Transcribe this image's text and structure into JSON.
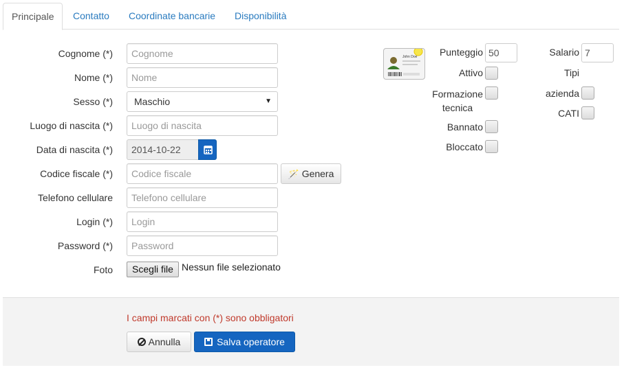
{
  "tabs": [
    "Principale",
    "Contatto",
    "Coordinate bancarie",
    "Disponibilità"
  ],
  "form": {
    "cognome_label": "Cognome (*)",
    "cognome_placeholder": "Cognome",
    "nome_label": "Nome (*)",
    "nome_placeholder": "Nome",
    "sesso_label": "Sesso (*)",
    "sesso_value": "Maschio",
    "luogo_label": "Luogo di nascita (*)",
    "luogo_placeholder": "Luogo di nascita",
    "data_label": "Data di nascita (*)",
    "data_value": "2014-10-22",
    "codice_label": "Codice fiscale (*)",
    "codice_placeholder": "Codice fiscale",
    "genera_label": "Genera",
    "telefono_label": "Telefono cellulare",
    "telefono_placeholder": "Telefono cellulare",
    "login_label": "Login (*)",
    "login_placeholder": "Login",
    "password_label": "Password (*)",
    "password_placeholder": "Password",
    "foto_label": "Foto",
    "file_button": "Scegli file",
    "file_status": "Nessun file selezionato"
  },
  "right": {
    "card_name": "John Doe",
    "punteggio_label": "Punteggio",
    "punteggio_value": "50",
    "salario_label": "Salario",
    "salario_value": "7",
    "attivo_label": "Attivo",
    "formazione_label_1": "Formazione",
    "formazione_label_2": "tecnica",
    "bannato_label": "Bannato",
    "bloccato_label": "Bloccato",
    "tipi_label": "Tipi",
    "azienda_label": "azienda",
    "cati_label": "CATI"
  },
  "footer": {
    "required_note": "I campi marcati con (*) sono obbligatori",
    "cancel_label": "Annulla",
    "save_label": "Salva operatore"
  },
  "colors": {
    "primary": "#1565c0",
    "link": "#2a7bbf",
    "required_text": "#c0392b"
  }
}
